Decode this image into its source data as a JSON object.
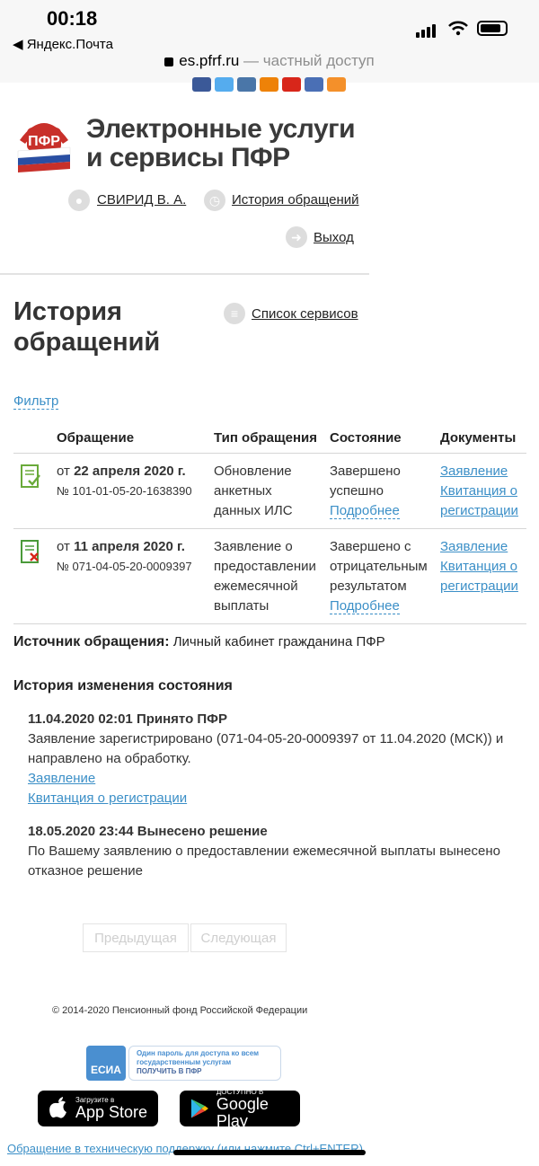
{
  "status_bar": {
    "time": "00:18",
    "back_app": "◀ Яндекс.Почта"
  },
  "browser": {
    "domain": "es.pfrf.ru",
    "separator": " — ",
    "privacy": "частный доступ"
  },
  "site": {
    "title_line1": "Электронные услуги",
    "title_line2": "и сервисы ПФР",
    "user_name": "СВИРИД В. А.",
    "history_link": "История обращений",
    "logout": "Выход"
  },
  "page": {
    "title_line1": "История",
    "title_line2": "обращений",
    "services_link": "Список сервисов",
    "filter": "Фильтр"
  },
  "table": {
    "headers": [
      "Обращение",
      "Тип обращения",
      "Состояние",
      "Документы"
    ],
    "rows": [
      {
        "date_prefix": "от ",
        "date": "22 апреля 2020 г.",
        "number": "№ 101-01-05-20-1638390",
        "type": "Обновление анкетных данных ИЛС",
        "status": "Завершено успешно",
        "details": "Подробнее",
        "doc1": "Заявление",
        "doc2": "Квитанция о регистрации"
      },
      {
        "date_prefix": "от ",
        "date": "11 апреля 2020 г.",
        "number": "№ 071-04-05-20-0009397",
        "type": "Заявление о предоставлении ежемесячной выплаты",
        "status": "Завершено с отрицательным результатом",
        "details": "Подробнее",
        "doc1": "Заявление",
        "doc2": "Квитанция о регистрации"
      }
    ]
  },
  "source": {
    "label": "Источник обращения:",
    "value": " Личный кабинет гражданина ПФР"
  },
  "history": {
    "title": "История изменения состояния",
    "events": [
      {
        "heading": "11.04.2020 02:01 Принято ПФР",
        "text": "Заявление зарегистрировано (071-04-05-20-0009397 от 11.04.2020 (МСК)) и направлено на обработку.",
        "link1": "Заявление",
        "link2": "Квитанция о регистрации"
      },
      {
        "heading": "18.05.2020 23:44 Вынесено решение",
        "text": "По Вашему заявлению о предоставлении ежемесячной выплаты вынесено отказное решение"
      }
    ]
  },
  "pagination": {
    "prev": "Предыдущая",
    "next": "Следующая"
  },
  "footer": {
    "copyright": "© 2014-2020 Пенсионный фонд Российской Федерации",
    "esia_badge": "ЕСИА",
    "esia_line1": "Один пароль для доступа ко всем",
    "esia_line2": "государственным услугам",
    "esia_line3": "ПОЛУЧИТЬ В ПФР",
    "appstore_small": "Загрузите в",
    "appstore_big": "App Store",
    "gplay_small": "ДОСТУПНО В",
    "gplay_big": "Google Play",
    "support_link": "Обращение в техническую поддержку (или нажмите Ctrl+ENTER)"
  },
  "colors": {
    "link": "#3b8fc7",
    "accent_red": "#c8302a",
    "ok_green": "#6aaa3a"
  }
}
